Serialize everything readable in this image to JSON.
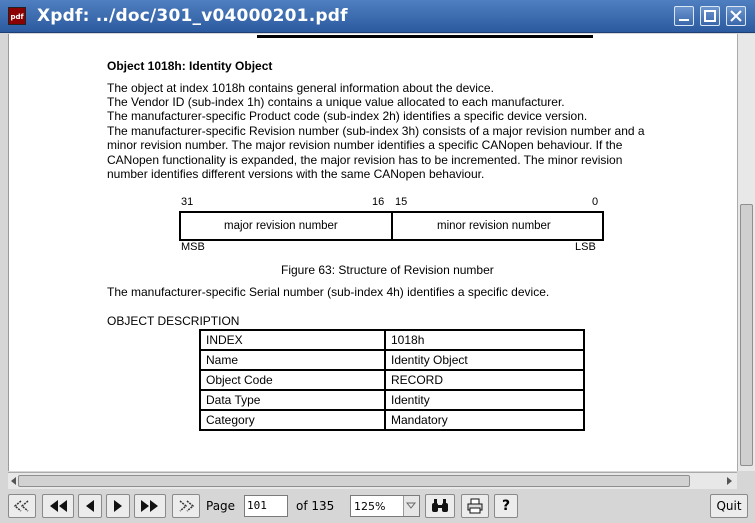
{
  "window": {
    "title": "Xpdf: ../doc/301_v04000201.pdf",
    "app_icon_text": "pdf",
    "controls": [
      "minimize-icon",
      "maximize-icon",
      "close-icon"
    ]
  },
  "document": {
    "heading": "Object 1018h: Identity Object",
    "paragraph_lines": [
      "The object at index 1018h contains general information about the device.",
      "The Vendor ID (sub-index 1h) contains a unique value allocated to each manufacturer.",
      "The manufacturer-specific Product code (sub-index 2h) identifies a specific device version.",
      "The manufacturer-specific Revision number (sub-index 3h) consists of a major revision number and a",
      "minor revision number. The major revision number identifies a specific CANopen behaviour. If the",
      "CANopen functionality is expanded, the major revision has to be incremented. The minor revision",
      "number identifies different versions with the same CANopen behaviour."
    ],
    "figure": {
      "bit_31": "31",
      "bit_16": "16",
      "bit_15": "15",
      "bit_0": "0",
      "major_label": "major revision number",
      "minor_label": "minor revision number",
      "msb": "MSB",
      "lsb": "LSB",
      "caption": "Figure 63: Structure of Revision number"
    },
    "serial_text": "The manufacturer-specific Serial number (sub-index 4h) identifies a specific device.",
    "object_description_label": "OBJECT DESCRIPTION",
    "object_table": [
      {
        "key": "INDEX",
        "value": "1018h"
      },
      {
        "key": "Name",
        "value": "Identity Object"
      },
      {
        "key": "Object Code",
        "value": "RECORD"
      },
      {
        "key": "Data Type",
        "value": "Identity"
      },
      {
        "key": "Category",
        "value": "Mandatory"
      }
    ]
  },
  "toolbar": {
    "page_label": "Page",
    "page_value": "101",
    "page_count": "of 135",
    "zoom_value": "125%",
    "quit_label": "Quit",
    "help_label": "?"
  }
}
